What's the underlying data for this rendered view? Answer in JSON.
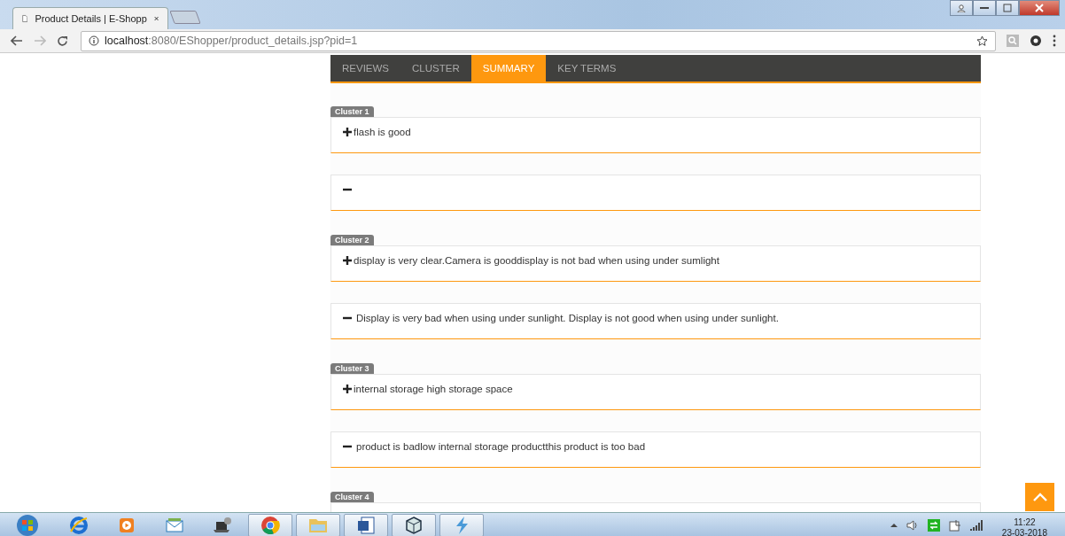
{
  "browser": {
    "tab_title": "Product Details | E-Shopp",
    "url_host": "localhost",
    "url_path": ":8080/EShopper/product_details.jsp?pid=1"
  },
  "tabs": [
    {
      "label": "REVIEWS",
      "selected": false
    },
    {
      "label": "CLUSTER",
      "selected": false
    },
    {
      "label": "SUMMARY",
      "selected": true
    },
    {
      "label": "KEY TERMS",
      "selected": false
    }
  ],
  "clusters": [
    {
      "label": "Cluster 1",
      "entries": [
        {
          "kind": "positive",
          "text": "flash is good"
        },
        {
          "kind": "negative"
        }
      ]
    },
    {
      "label": "Cluster 2",
      "entries": [
        {
          "kind": "positive",
          "text": "display is very clear.Camera is gooddisplay is not bad when using under sumlight"
        },
        {
          "kind": "negative",
          "text": "Display is very bad when using under sunlight. Display is not good when using under sunlight."
        }
      ]
    },
    {
      "label": "Cluster 3",
      "entries": [
        {
          "kind": "positive",
          "text": "internal storage high storage space"
        },
        {
          "kind": "negative",
          "text": "product is badlow internal storage productthis product is too bad"
        }
      ]
    },
    {
      "label": "Cluster 4"
    }
  ],
  "taskbar": {
    "apps": [
      {
        "kind": "ie",
        "open": false
      },
      {
        "kind": "media",
        "open": false
      },
      {
        "kind": "mail",
        "open": false
      },
      {
        "kind": "laptop",
        "open": false
      },
      {
        "kind": "chrome",
        "open": true
      },
      {
        "kind": "folder",
        "open": true
      },
      {
        "kind": "word",
        "open": true
      },
      {
        "kind": "cube",
        "open": true
      },
      {
        "kind": "bolt",
        "open": true
      }
    ],
    "time": "11:22",
    "date": "23-03-2018"
  }
}
